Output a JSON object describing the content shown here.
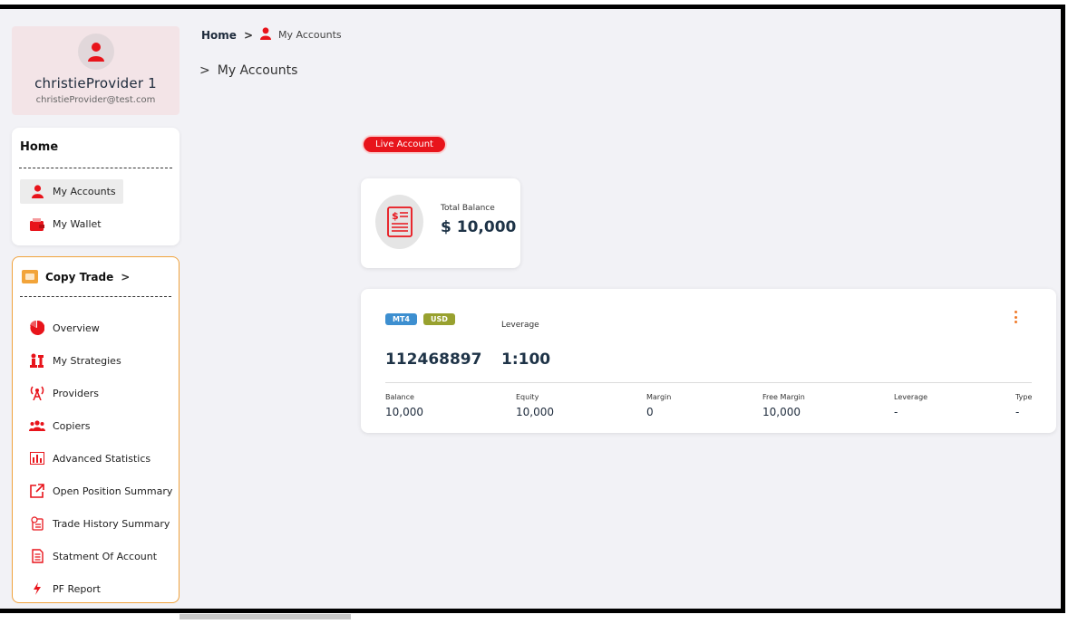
{
  "breadcrumb": {
    "home": "Home",
    "current": "My Accounts"
  },
  "page_title": "My Accounts",
  "profile": {
    "name": "christieProvider 1",
    "email": "christieProvider@test.com"
  },
  "home_card": {
    "title": "Home",
    "items": [
      {
        "label": "My Accounts",
        "icon": "user-icon",
        "active": true
      },
      {
        "label": "My Wallet",
        "icon": "wallet-icon",
        "active": false
      }
    ]
  },
  "copy_trade": {
    "title": "Copy Trade",
    "items": [
      {
        "label": "Overview",
        "icon": "pie-chart-icon"
      },
      {
        "label": "My Strategies",
        "icon": "chess-icon"
      },
      {
        "label": "Providers",
        "icon": "broadcast-tower-icon"
      },
      {
        "label": "Copiers",
        "icon": "users-icon"
      },
      {
        "label": "Advanced Statistics",
        "icon": "bar-chart-icon"
      },
      {
        "label": "Open Position Summary",
        "icon": "external-link-icon"
      },
      {
        "label": "Trade History Summary",
        "icon": "history-doc-icon"
      },
      {
        "label": "Statment Of Account",
        "icon": "document-icon"
      },
      {
        "label": "PF Report",
        "icon": "lightning-icon"
      }
    ]
  },
  "live_badge": "Live Account",
  "balance": {
    "label": "Total Balance",
    "value": "$ 10,000"
  },
  "account": {
    "platform": "MT4",
    "currency": "USD",
    "leverage_label": "Leverage",
    "number": "112468897",
    "leverage_value": "1:100",
    "stats": [
      {
        "label": "Balance",
        "value": "10,000"
      },
      {
        "label": "Equity",
        "value": "10,000"
      },
      {
        "label": "Margin",
        "value": "0"
      },
      {
        "label": "Free Margin",
        "value": "10,000"
      },
      {
        "label": "Leverage",
        "value": "-"
      },
      {
        "label": "Type",
        "value": "-"
      }
    ]
  },
  "colors": {
    "accent": "#e8141b",
    "copy_border": "#f0a23c",
    "mt4_tag": "#3d8fd0",
    "usd_tag": "#98a12f",
    "text_dark": "#1e3347"
  }
}
